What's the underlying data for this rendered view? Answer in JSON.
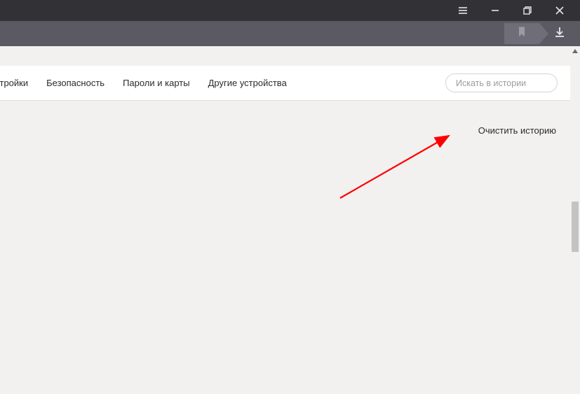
{
  "tabs": {
    "settings": "стройки",
    "security": "Безопасность",
    "passwords": "Пароли и карты",
    "devices": "Другие устройства"
  },
  "search": {
    "placeholder": "Искать в истории"
  },
  "actions": {
    "clear_history": "Очистить историю"
  }
}
